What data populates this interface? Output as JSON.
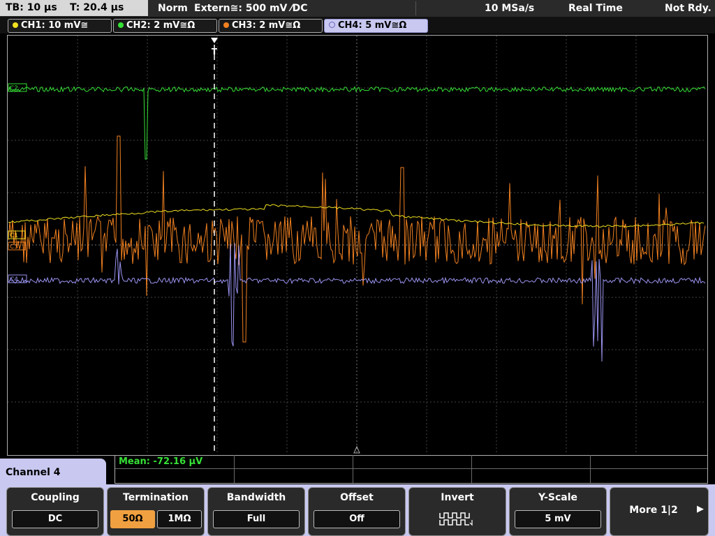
{
  "status": {
    "timebase": "TB: 10 µs",
    "trigger_time": "T: 20.4 µs",
    "mode": "Norm",
    "trigger_source": "Extern≅: 500 mV ⁄DC",
    "sample_rate": "10 MSa/s",
    "acq_mode": "Real Time",
    "state": "Not Rdy."
  },
  "channels": [
    {
      "label": "CH1: 10 mV≅",
      "color": "#f0e020"
    },
    {
      "label": "CH2: 2 mV≅Ω",
      "color": "#36e036"
    },
    {
      "label": "CH3: 2 mV≅Ω",
      "color": "#f08020"
    },
    {
      "label": "CH4: 5 mV≅Ω",
      "color": "#9a94f0"
    }
  ],
  "trace_labels": {
    "ch1": "C1",
    "ch2": "C2",
    "ch3": "C3",
    "ch4": "C4"
  },
  "trigger_marker": "T",
  "measurement": "Mean: -72.16 µV",
  "menu": {
    "title": "Channel 4",
    "coupling": {
      "label": "Coupling",
      "value": "DC"
    },
    "termination": {
      "label": "Termination",
      "opt1": "50Ω",
      "opt2": "1MΩ"
    },
    "bandwidth": {
      "label": "Bandwidth",
      "value": "Full"
    },
    "offset": {
      "label": "Offset",
      "value": "Off"
    },
    "invert": {
      "label": "Invert"
    },
    "yscale": {
      "label": "Y-Scale",
      "value": "5 mV"
    },
    "more": {
      "label": "More 1|2"
    }
  },
  "colors": {
    "grid": "#555555",
    "accent_menu": "#c8c8f0",
    "selected": "#f0a040"
  }
}
